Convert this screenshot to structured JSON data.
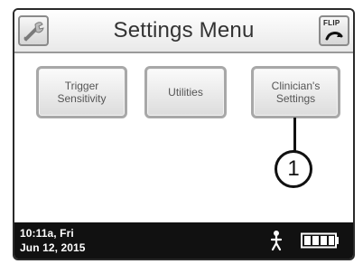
{
  "header": {
    "title": "Settings Menu",
    "left_icon": "wrench-icon",
    "right_icon": {
      "name": "flip-icon",
      "label": "FLIP"
    }
  },
  "menu_buttons": [
    {
      "id": "trigger-sensitivity",
      "line1": "Trigger",
      "line2": "Sensitivity"
    },
    {
      "id": "utilities",
      "line1": "Utilities"
    },
    {
      "id": "clinicians-settings",
      "line1": "Clinician's",
      "line2": "Settings"
    }
  ],
  "callout": {
    "label": "1"
  },
  "status": {
    "time_day": "10:11a, Fri",
    "date": "Jun 12, 2015",
    "person_icon": "person-icon",
    "battery_icon": "battery-icon",
    "battery_level_fraction": 1
  },
  "colors": {
    "status_bar_bg": "#111111",
    "button_border": "#a8a8a8",
    "text_dark": "#333333"
  }
}
